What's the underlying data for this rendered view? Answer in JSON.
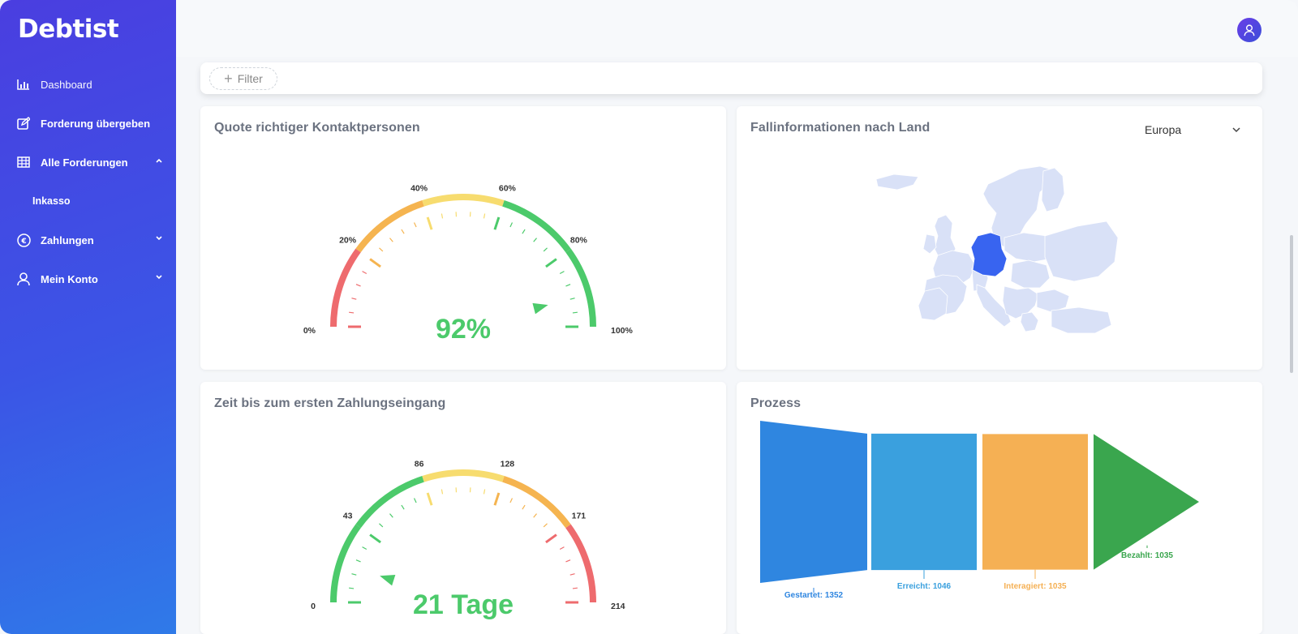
{
  "app": {
    "logo": "Debtist"
  },
  "nav": {
    "items": [
      {
        "label": "Dashboard",
        "icon": "chart-icon"
      },
      {
        "label": "Forderung übergeben",
        "icon": "edit-icon"
      },
      {
        "label": "Alle Forderungen",
        "icon": "table-icon"
      },
      {
        "label": "Inkasso"
      },
      {
        "label": "Zahlungen",
        "icon": "euro-icon"
      },
      {
        "label": "Mein Konto",
        "icon": "user-icon"
      }
    ]
  },
  "filter": {
    "label": "Filter"
  },
  "cards": {
    "contact": {
      "title": "Quote richtiger Kontaktpersonen",
      "ticks": [
        "0%",
        "20%",
        "40%",
        "60%",
        "80%",
        "100%"
      ],
      "value": 92,
      "max": 100,
      "value_label": "92%"
    },
    "country": {
      "title": "Fallinformationen nach Land",
      "region": "Europa",
      "highlighted_country": "Germany"
    },
    "payment": {
      "title": "Zeit bis zum ersten Zahlungseingang",
      "ticks": [
        "0",
        "43",
        "86",
        "128",
        "171",
        "214"
      ],
      "value": 21,
      "max": 214,
      "value_label": "21 Tage"
    },
    "process": {
      "title": "Prozess",
      "stages": [
        {
          "label": "Gestartet: 1352",
          "value": 1352
        },
        {
          "label": "Erreicht: 1046",
          "value": 1046
        },
        {
          "label": "Interagiert: 1035",
          "value": 1035
        },
        {
          "label": "Bezahlt: 1035",
          "value": 1035
        }
      ]
    }
  },
  "colors": {
    "red": "#ee6b6e",
    "orange": "#f5b450",
    "yellow": "#f7dc6f",
    "green": "#4cca6b",
    "map_base": "#d9e1f7",
    "map_highlight": "#3864f0",
    "funnel": [
      "#2f86e0",
      "#3aa0de",
      "#f5b054",
      "#3aa64e"
    ]
  }
}
